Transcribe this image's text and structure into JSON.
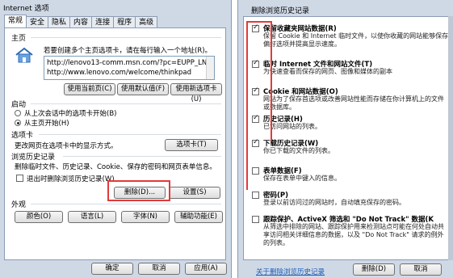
{
  "left": {
    "title": "Internet 选项",
    "tabs": [
      "常规",
      "安全",
      "隐私",
      "内容",
      "连接",
      "程序",
      "高级"
    ],
    "homepage": {
      "group": "主页",
      "desc": "若要创建多个主页选项卡，请在每行输入一个地址(R)。",
      "urls": [
        "http://lenovo13-comm.msn.com/?pc=EUPP_LN",
        "http://www.lenovo.com/welcome/thinkpad"
      ],
      "btn_current": "使用当前页(C)",
      "btn_default": "使用默认值(F)",
      "btn_new_tab": "使用新选项卡(U)"
    },
    "startup": {
      "group": "启动",
      "opt1": "从上次会话中的选项卡开始(B)",
      "opt2": "从主页开始(H)"
    },
    "tabs_group": {
      "group": "选项卡",
      "desc": "更改网页在选项卡中的显示方式。",
      "btn": "选项卡(T)"
    },
    "history": {
      "group": "浏览历史记录",
      "desc": "删除临时文件、历史记录、Cookie、保存的密码和网页表单信息。",
      "exit_label": "退出时删除浏览历史记录(W)",
      "btn_delete": "删除(D)...",
      "btn_settings": "设置(S)"
    },
    "appearance": {
      "group": "外观",
      "btn_colors": "颜色(O)",
      "btn_language": "语言(L)",
      "btn_fonts": "字体(N)",
      "btn_access": "辅助功能(E)"
    },
    "footer": {
      "ok": "确定",
      "cancel": "取消",
      "apply": "应用(A)"
    }
  },
  "right": {
    "title": "删除浏览历史记录",
    "items": [
      {
        "title": "保留收藏夹网站数据(R)",
        "desc": "保留 Cookie 和 Internet 临时文件，以使你收藏的网站能够保存偏好选项并提高显示速度。",
        "checked": true
      },
      {
        "title": "临时 Internet 文件和网站文件(T)",
        "desc": "为快速查看而保存的网页、图像和媒体的副本",
        "checked": true
      },
      {
        "title": "Cookie 和网站数据(O)",
        "desc": "网站为了保存首选项或改善网站性能而存储在你计算机上的文件或数据库。",
        "checked": true
      },
      {
        "title": "历史记录(H)",
        "desc": "已访问网站的列表。",
        "checked": true
      },
      {
        "title": "下载历史记录(W)",
        "desc": "你已下载的文件的列表。",
        "checked": true
      },
      {
        "title": "表单数据(F)",
        "desc": "保存在表单中键入的信息。",
        "checked": false
      },
      {
        "title": "密码(P)",
        "desc": "登录以前访问过的网站时，自动填充保存的密码。",
        "checked": false
      },
      {
        "title": "跟踪保护、ActiveX 筛选和 \"Do Not Track\" 数据(K",
        "desc": "从筛选中排除的网站、跟踪保护用来检测站点可能在何处自动共享访问相关详细信息的数据，以及 \"Do Not Track\" 请求的例外的列表。",
        "checked": false
      }
    ],
    "link": "关于删除浏览历史记录",
    "btn_delete": "删除(D)",
    "btn_cancel": "取消"
  }
}
